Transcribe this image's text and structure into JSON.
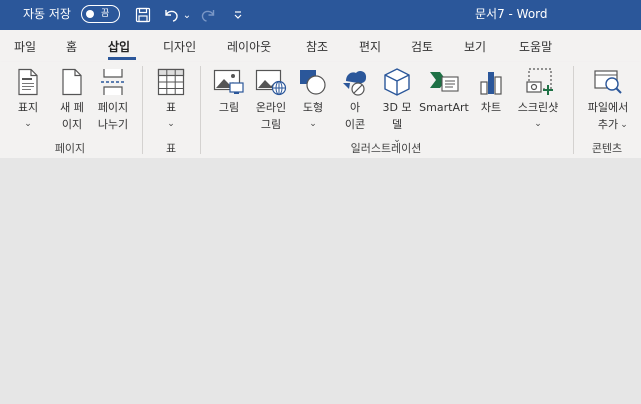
{
  "titlebar": {
    "autosave_label": "자동 저장",
    "autosave_state": "끔",
    "more_glyph": "⌄",
    "doc_title": "문서7  -  Word"
  },
  "tabs": [
    "파일",
    "홈",
    "삽입",
    "디자인",
    "레이아웃",
    "참조",
    "편지",
    "검토",
    "보기",
    "도움말"
  ],
  "active_tab": "삽입",
  "ribbon": {
    "groups": {
      "pages": "페이지",
      "tables": "표",
      "illustrations": "일러스트레이션",
      "contents": "콘텐츠"
    },
    "buttons": {
      "cover": {
        "l1": "표지",
        "chev": "⌄"
      },
      "blank": {
        "l1": "새 페",
        "l2": "이지"
      },
      "break": {
        "l1": "페이지",
        "l2": "나누기"
      },
      "table": {
        "l1": "표",
        "chev": "⌄"
      },
      "pictures": {
        "l1": "그림"
      },
      "online": {
        "l1": "온라인",
        "l2": "그림"
      },
      "shapes": {
        "l1": "도형",
        "chev": "⌄"
      },
      "icons": {
        "l1": "아",
        "l2": "이콘"
      },
      "model3d": {
        "l1": "3D 모",
        "l2": "델",
        "chev": "⌄"
      },
      "smartart": {
        "l1": "SmartArt"
      },
      "chart": {
        "l1": "차트"
      },
      "screenshot": {
        "l1": "스크린샷",
        "chev": "⌄"
      },
      "addins": {
        "l1": "파일에서",
        "l2": "추가",
        "chev": "⌄"
      }
    }
  }
}
